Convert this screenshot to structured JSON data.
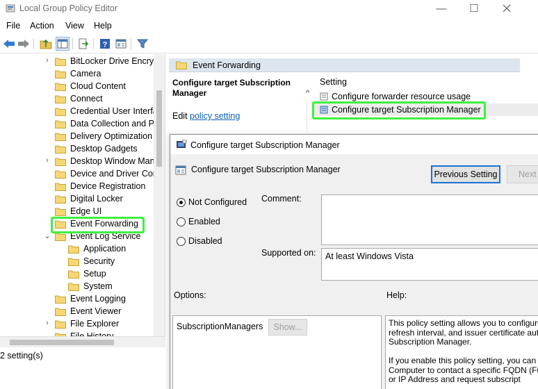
{
  "window": {
    "title": "Local Group Policy Editor",
    "controls": {
      "minimize": "—",
      "maximize": "☐"
    }
  },
  "menu": [
    "File",
    "Action",
    "View",
    "Help"
  ],
  "toolbar_icons": [
    "back-arrow-icon",
    "forward-arrow-icon",
    "up-folder-icon",
    "show-hide-tree-icon",
    "export-list-icon",
    "help-icon",
    "properties-icon",
    "filter-icon"
  ],
  "tree": {
    "items": [
      {
        "label": "BitLocker Drive Encryp",
        "expand": "›"
      },
      {
        "label": "Camera",
        "expand": ""
      },
      {
        "label": "Cloud Content",
        "expand": ""
      },
      {
        "label": "Connect",
        "expand": ""
      },
      {
        "label": "Credential User Interfa",
        "expand": ""
      },
      {
        "label": "Data Collection and Pr",
        "expand": ""
      },
      {
        "label": "Delivery Optimization",
        "expand": ""
      },
      {
        "label": "Desktop Gadgets",
        "expand": ""
      },
      {
        "label": "Desktop Window Man",
        "expand": "›"
      },
      {
        "label": "Device and Driver Con",
        "expand": ""
      },
      {
        "label": "Device Registration",
        "expand": ""
      },
      {
        "label": "Digital Locker",
        "expand": ""
      },
      {
        "label": "Edge UI",
        "expand": ""
      },
      {
        "label": "Event Forwarding",
        "expand": ""
      },
      {
        "label": "Event Log Service",
        "expand": "⌄"
      },
      {
        "label": "Application",
        "expand": "",
        "child": true
      },
      {
        "label": "Security",
        "expand": "",
        "child": true
      },
      {
        "label": "Setup",
        "expand": "",
        "child": true
      },
      {
        "label": "System",
        "expand": "",
        "child": true
      },
      {
        "label": "Event Logging",
        "expand": ""
      },
      {
        "label": "Event Viewer",
        "expand": ""
      },
      {
        "label": "File Explorer",
        "expand": "›"
      },
      {
        "label": "File History",
        "expand": ""
      }
    ]
  },
  "right_pane": {
    "header": "Event Forwarding",
    "selected_title": "Configure target Subscription Manager",
    "edit_prefix": "Edit ",
    "edit_link": "policy setting",
    "setting_col": "Setting",
    "settings": [
      "Configure forwarder resource usage",
      "Configure target Subscription Manager"
    ]
  },
  "statusbar": "2 setting(s)",
  "dialog": {
    "title": "Configure target Subscription Manager",
    "header": "Configure target Subscription Manager",
    "prev_button": "Previous Setting",
    "next_button": "Next Setting",
    "radios": [
      {
        "label": "Not Configured",
        "checked": true
      },
      {
        "label": "Enabled",
        "checked": false
      },
      {
        "label": "Disabled",
        "checked": false
      }
    ],
    "comment_label": "Comment:",
    "supported_label": "Supported on:",
    "supported_value": "At least Windows Vista",
    "options_label": "Options:",
    "help_label": "Help:",
    "option_name": "SubscriptionManagers",
    "show_button": "Show...",
    "help_p1": "This policy setting allows you to configure refresh interval, and issuer certificate auth Subscription Manager.",
    "help_p2": "If you enable this policy setting, you can c Computer to contact a specific FQDN (Fu Name) or IP Address and request subscript"
  },
  "colors": {
    "highlight": "#3ef03e",
    "link": "#0a5fb4",
    "header_bg": "#dde6ef",
    "dialog_bg": "#f0f0f0"
  }
}
